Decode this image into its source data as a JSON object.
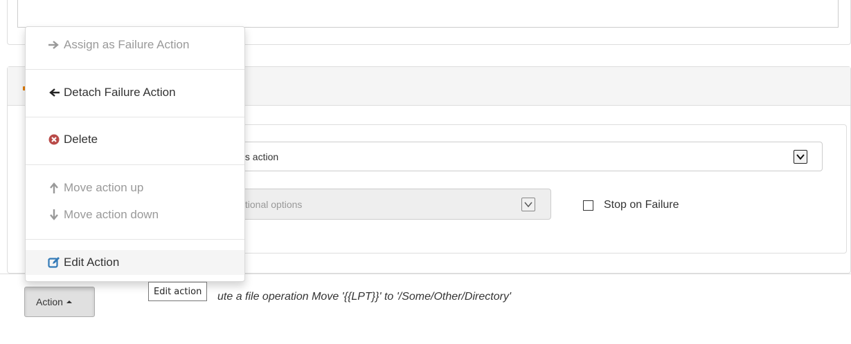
{
  "menu": {
    "assign_failure": "Assign as Failure Action",
    "detach_failure": "Detach Failure Action",
    "delete": "Delete",
    "move_up": "Move action up",
    "move_down": "Move action down",
    "edit": "Edit Action"
  },
  "form": {
    "main_select_visible_text": "his action",
    "options_select_visible_text": "ditional options",
    "stop_on_failure_label": "Stop on Failure",
    "stop_on_failure_checked": false
  },
  "footer": {
    "action_button_label": "Action",
    "description_visible_text": "ute a file operation Move '{{LPT}}' to '/Some/Other/Directory'"
  },
  "tooltip": {
    "text": "Edit action"
  },
  "colors": {
    "delete_icon": "#b94a48",
    "edit_icon": "#337ab7",
    "disabled_text": "#999999",
    "panel_heading_bg": "#f5f5f5"
  },
  "icons": {
    "assign": "arrow-right-icon",
    "detach": "arrow-left-icon",
    "delete": "remove-sign-icon",
    "move_up": "arrow-up-icon",
    "move_down": "arrow-down-icon",
    "edit": "edit-icon"
  }
}
